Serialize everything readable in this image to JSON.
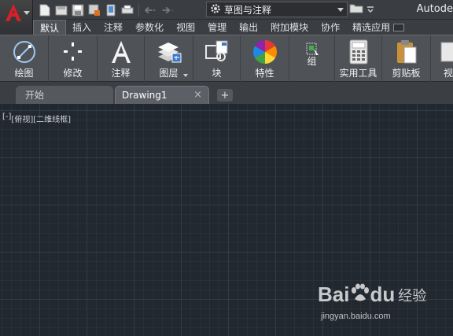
{
  "app": {
    "title_partial": "Autode",
    "workspace": "草图与注释"
  },
  "ribbon_tabs": [
    {
      "label": "默认",
      "active": true
    },
    {
      "label": "插入"
    },
    {
      "label": "注释"
    },
    {
      "label": "参数化"
    },
    {
      "label": "视图"
    },
    {
      "label": "管理"
    },
    {
      "label": "输出"
    },
    {
      "label": "附加模块"
    },
    {
      "label": "协作"
    },
    {
      "label": "精选应用"
    }
  ],
  "ribbon_panels": [
    {
      "label": "绘图",
      "icon": "draw-icon"
    },
    {
      "label": "修改",
      "icon": "modify-icon"
    },
    {
      "label": "注释",
      "icon": "annotation-icon"
    },
    {
      "label": "图层",
      "icon": "layers-icon"
    },
    {
      "label": "块",
      "icon": "block-icon"
    },
    {
      "label": "特性",
      "icon": "properties-icon"
    },
    {
      "label": "组",
      "icon": "group-icon"
    },
    {
      "label": "实用工具",
      "icon": "utilities-icon"
    },
    {
      "label": "剪贴板",
      "icon": "clipboard-icon"
    },
    {
      "label": "视",
      "icon": "view-icon"
    }
  ],
  "file_tabs": {
    "start": "开始",
    "drawing": "Drawing1",
    "close": "×",
    "add": "+"
  },
  "viewport": {
    "control": "[-]",
    "view": "[俯视]",
    "style": "[二维线框]"
  },
  "watermark": {
    "brand": "Bai",
    "brand2": "du",
    "cn": "经验",
    "url": "jingyan.baidu.com"
  },
  "colors": {
    "app_red": "#c0141e",
    "canvas_bg": "#212830",
    "ribbon_bg": "#4f5358"
  }
}
